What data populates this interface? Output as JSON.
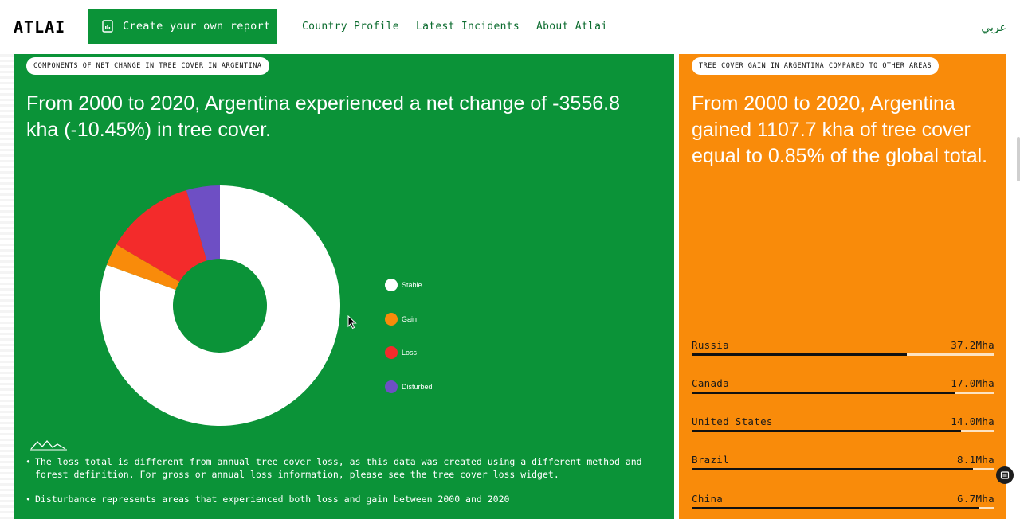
{
  "header": {
    "logo": "ATLAI",
    "create_button": "Create your own report",
    "nav": [
      {
        "label": "Country Profile",
        "active": true
      },
      {
        "label": "Latest Incidents",
        "active": false
      },
      {
        "label": "About Atlai",
        "active": false
      }
    ],
    "language": "عربي"
  },
  "green_card": {
    "tag": "COMPONENTS OF NET CHANGE IN TREE COVER IN ARGENTINA",
    "headline": "From 2000 to 2020, Argentina experienced a net change of -3556.8 kha (-10.45%) in tree cover.",
    "notes": [
      "The loss total is different from annual tree cover loss, as this data was created using a different method and forest definition. For gross or annual loss information, please see the tree cover loss widget.",
      "Disturbance represents areas that experienced both loss and gain between 2000 and 2020"
    ]
  },
  "chart_data": {
    "type": "pie",
    "donut": true,
    "categories": [
      "Stable",
      "Gain",
      "Loss",
      "Disturbed"
    ],
    "values": [
      80.5,
      3.0,
      12.0,
      4.5
    ],
    "colors": [
      "#ffffff",
      "#f98b0a",
      "#f32b2b",
      "#6e4fc4"
    ],
    "legend_position": "right"
  },
  "orange_card": {
    "tag": "TREE COVER GAIN IN ARGENTINA COMPARED TO OTHER AREAS",
    "headline": "From 2000 to 2020, Argentina gained 1107.7 kha of tree cover equal to 0.85% of the global total.",
    "ranking": [
      {
        "name": "Russia",
        "value": "37.2Mha",
        "fraction": 0.71
      },
      {
        "name": "Canada",
        "value": "17.0Mha",
        "fraction": 0.87
      },
      {
        "name": "United States",
        "value": "14.0Mha",
        "fraction": 0.89
      },
      {
        "name": "Brazil",
        "value": "8.1Mha",
        "fraction": 0.93
      },
      {
        "name": "China",
        "value": "6.7Mha",
        "fraction": 0.95
      }
    ]
  },
  "colors": {
    "green": "#0b9338",
    "orange": "#f98b0a"
  }
}
